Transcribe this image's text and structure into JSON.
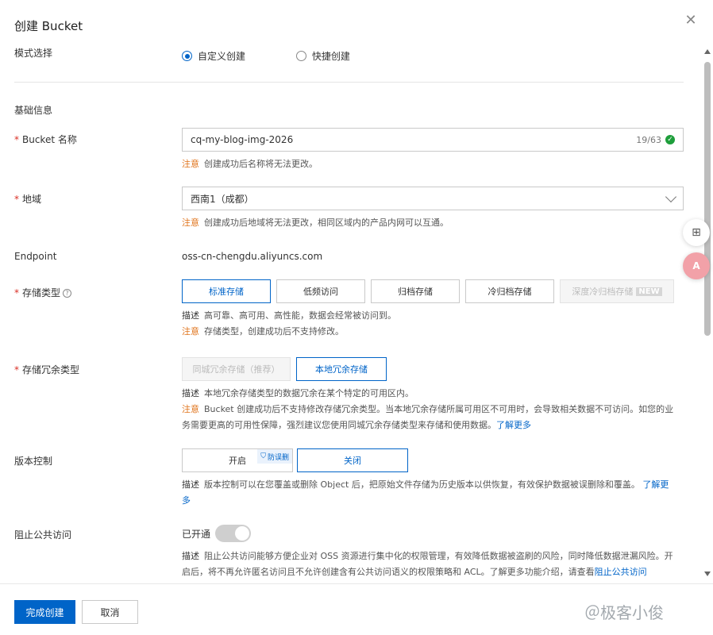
{
  "dialog": {
    "title": "创建 Bucket"
  },
  "mode": {
    "label": "模式选择",
    "options": [
      {
        "label": "自定义创建",
        "selected": true
      },
      {
        "label": "快捷创建",
        "selected": false
      }
    ]
  },
  "section_basic": "基础信息",
  "bucket_name": {
    "label": "Bucket 名称",
    "value": "cq-my-blog-img-2026",
    "counter": "19/63",
    "note_tag": "注意",
    "note": "创建成功后名称将无法更改。"
  },
  "region": {
    "label": "地域",
    "value": "西南1（成都）",
    "note_tag": "注意",
    "note": "创建成功后地域将无法更改，相同区域内的产品内网可以互通。"
  },
  "endpoint": {
    "label": "Endpoint",
    "value": "oss-cn-chengdu.aliyuncs.com"
  },
  "storage_class": {
    "label": "存储类型",
    "options": [
      {
        "label": "标准存储",
        "state": "selected"
      },
      {
        "label": "低频访问",
        "state": "normal"
      },
      {
        "label": "归档存储",
        "state": "normal"
      },
      {
        "label": "冷归档存储",
        "state": "normal"
      },
      {
        "label": "深度冷归档存储",
        "state": "disabled"
      }
    ],
    "new_badge": "NEW",
    "desc_tag": "描述",
    "desc": "高可靠、高可用、高性能，数据会经常被访问到。",
    "note_tag": "注意",
    "note": "存储类型，创建成功后不支持修改。"
  },
  "redundancy": {
    "label": "存储冗余类型",
    "options": [
      {
        "label": "同城冗余存储（推荐）",
        "state": "disabled"
      },
      {
        "label": "本地冗余存储",
        "state": "selected"
      }
    ],
    "desc_tag": "描述",
    "desc": "本地冗余存储类型的数据冗余在某个特定的可用区内。",
    "note_tag": "注意",
    "note_line1": "Bucket 创建成功后不支持修改存储冗余类型。当本地冗余存储所属可用区不可用时，会导致相关数据不可访问。如您的业",
    "note_line2": "务需要更高的可用性保障，强烈建议您使用同城冗余存储类型来存储和使用数据。",
    "note_link": "了解更多"
  },
  "versioning": {
    "label": "版本控制",
    "on_label": "开启",
    "protect_tag": "防误删",
    "off_label": "关闭",
    "desc_tag": "描述",
    "desc": "版本控制可以在您覆盖或删除 Object 后，把原始文件存储为历史版本以供恢复，有效保护数据被误删除和覆盖。",
    "link_part1": "了解更",
    "link_part2": "多"
  },
  "public_access": {
    "label": "阻止公共访问",
    "status": "已开通",
    "enabled": true,
    "desc_tag": "描述",
    "desc_line1": "阻止公共访问能够方便企业对 OSS 资源进行集中化的权限管理，有效降低数据被盗刷的风险，同时降低数据泄漏风险。开",
    "desc_line2": "启后，将不再允许匿名访问且不允许创建含有公共访问语义的权限策略和 ACL。了解更多功能介绍，请查看",
    "link": "阻止公共访问"
  },
  "footer": {
    "submit": "完成创建",
    "cancel": "取消"
  },
  "watermark": "＠极客小俊",
  "colors": {
    "primary": "#0064c8",
    "warning": "#e0741c",
    "success": "#1e9e3b"
  }
}
